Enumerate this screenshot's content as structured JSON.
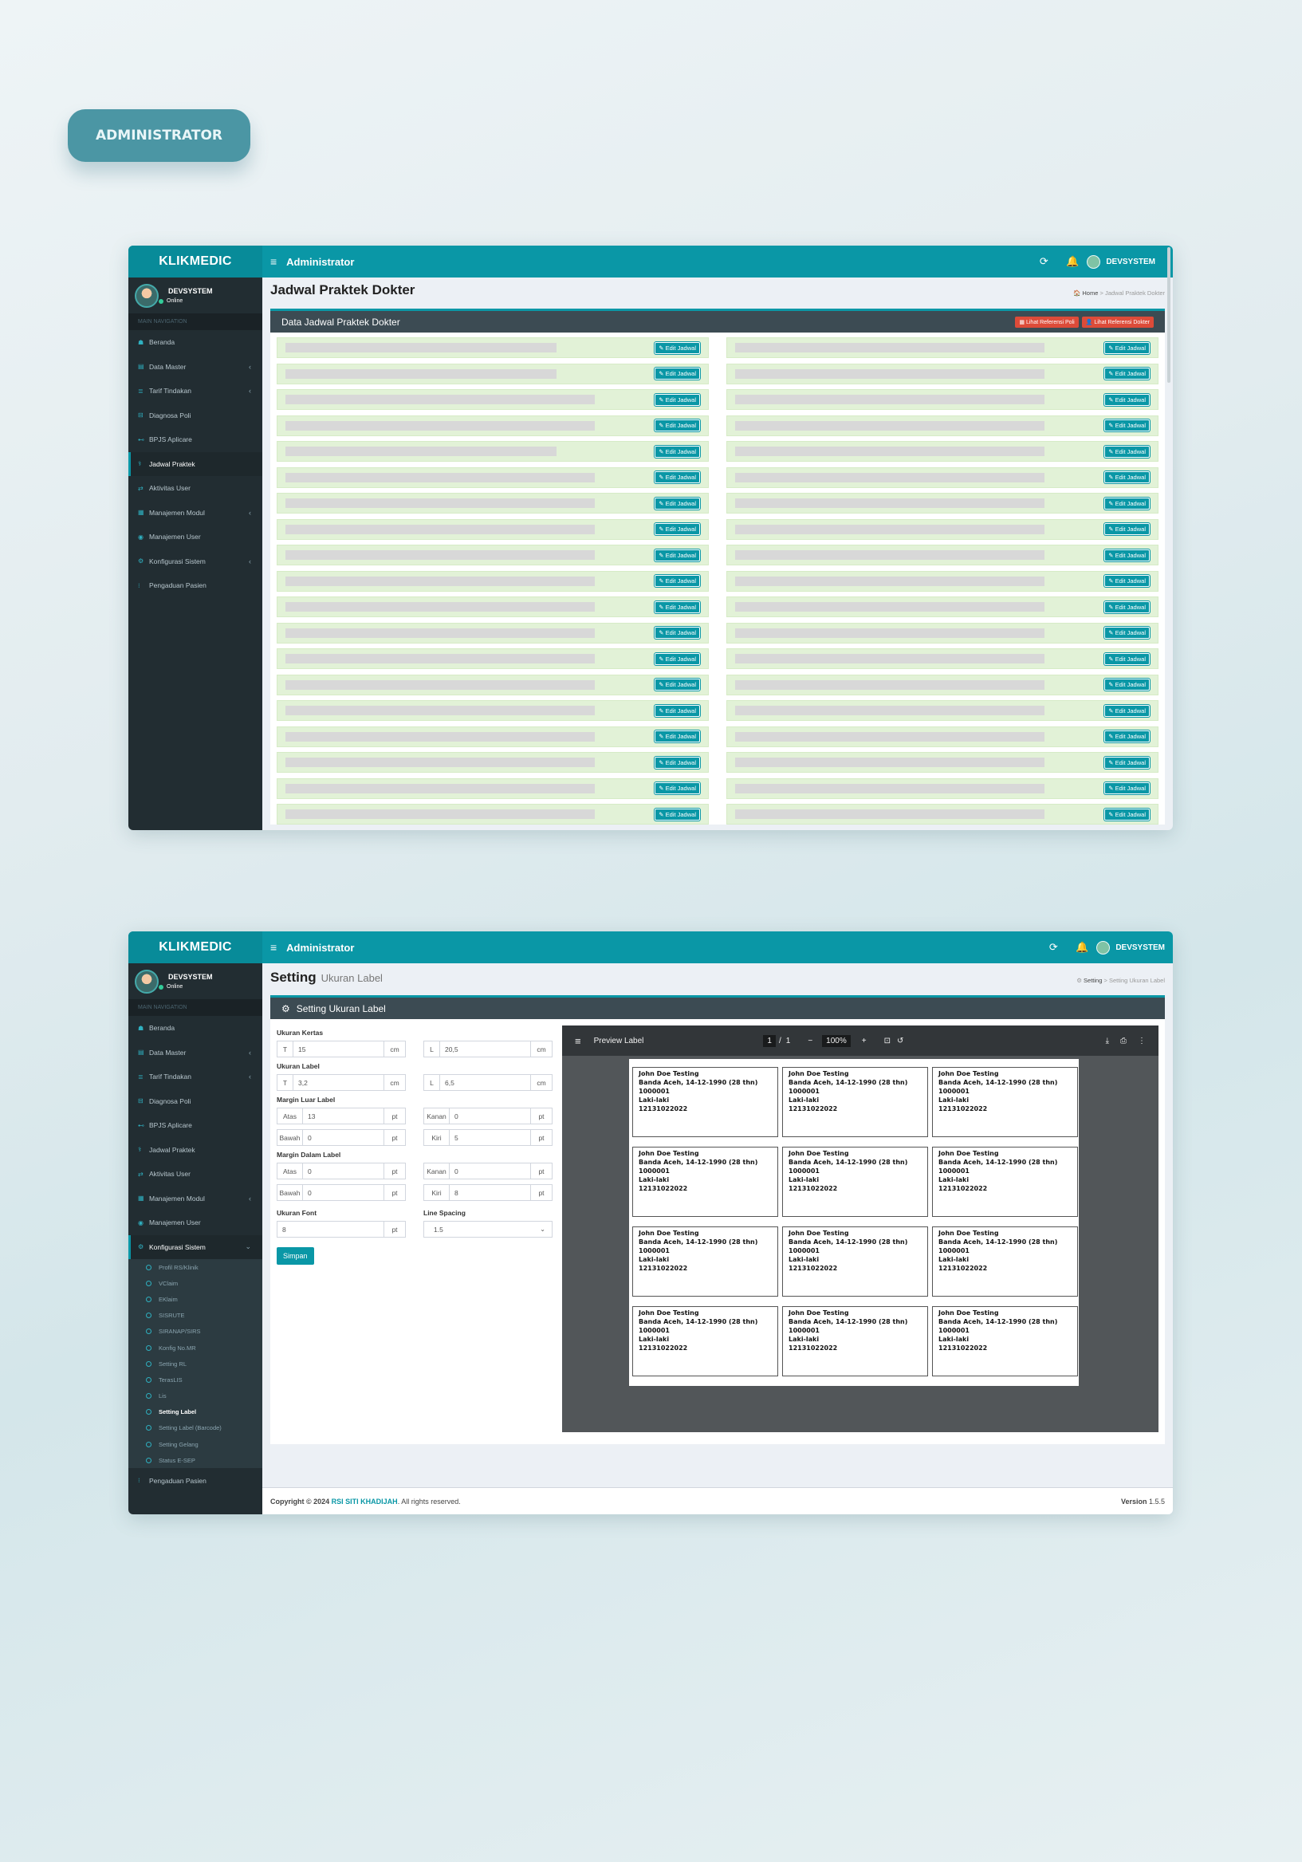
{
  "badge": "ADMINISTRATOR",
  "brand": "KLIKMEDIC",
  "topbar": {
    "title": "Administrator",
    "refresh_icon": "⟳",
    "bell_icon": "🔔",
    "user": "DEVSYSTEM"
  },
  "sidebar": {
    "user": "DEVSYSTEM",
    "status": "Online",
    "nav_header": "MAIN NAVIGATION",
    "items": [
      "Beranda",
      "Data Master",
      "Tarif Tindakan",
      "Diagnosa Poli",
      "BPJS Aplicare",
      "Jadwal Praktek",
      "Aktivitas User",
      "Manajemen Modul",
      "Manajemen User",
      "Konfigurasi Sistem",
      "Pengaduan Pasien"
    ],
    "sub_items": [
      "Profil RS/Klinik",
      "VClaim",
      "EKlaim",
      "SISRUTE",
      "SIRANAP/SIRS",
      "Konfig No.MR",
      "Setting RL",
      "TerasLIS",
      "Lis",
      "Setting Label",
      "Setting Label (Barcode)",
      "Setting Gelang",
      "Status E-SEP"
    ]
  },
  "page1": {
    "title": "Jadwal Praktek Dokter",
    "crumb_home": "Home",
    "crumb_current": "Jadwal Praktek Dokter",
    "box_title": "Data Jadwal Praktek Dokter",
    "btn_poli": "▦ Lihat Referensi Poli",
    "btn_dokter": "👤 Lihat Referensi Dokter",
    "edit_label": "✎ Edit Jadwal"
  },
  "page2": {
    "title": "Setting",
    "subtitle": "Ukuran Label",
    "crumb_home": "Setting",
    "crumb_current": "Setting Ukuran Label",
    "box_title": "Setting Ukuran Label",
    "kertas": {
      "label": "Ukuran Kertas",
      "t_pre": "T",
      "t": "15",
      "l_pre": "L",
      "l": "20,5",
      "unit": "cm"
    },
    "ukuran_label": {
      "label": "Ukuran Label",
      "t_pre": "T",
      "t": "3,2",
      "l_pre": "L",
      "l": "6,5",
      "unit": "cm"
    },
    "margin_luar": {
      "label": "Margin Luar Label",
      "atas_pre": "Atas",
      "atas": "13",
      "kanan_pre": "Kanan",
      "kanan": "0",
      "bawah_pre": "Bawah",
      "bawah": "0",
      "kiri_pre": "Kiri",
      "kiri": "5",
      "unit": "pt"
    },
    "margin_dalam": {
      "label": "Margin Dalam Label",
      "atas_pre": "Atas",
      "atas": "0",
      "kanan_pre": "Kanan",
      "kanan": "0",
      "bawah_pre": "Bawah",
      "bawah": "0",
      "kiri_pre": "Kiri",
      "kiri": "8",
      "unit": "pt"
    },
    "font": {
      "label": "Ukuran Font",
      "value": "8",
      "unit": "pt"
    },
    "spacing": {
      "label": "Line Spacing",
      "value": "1.5"
    },
    "save": "Simpan",
    "viewer": {
      "title": "Preview Label",
      "page": "1",
      "sep": "/",
      "pages": "1",
      "zoom": "100%"
    },
    "label_card": {
      "name": "John Doe Testing",
      "birth": "Banda Aceh, 14-12-1990 (28 thn)",
      "mr": "1000001",
      "sex": "Laki-laki",
      "code": "12131022022"
    },
    "footer_prefix": "Copyright © 2024",
    "footer_org": "RSI SITI KHADIJAH",
    "footer_suffix": ". All rights reserved.",
    "version_label": "Version",
    "version": "1.5.5"
  }
}
